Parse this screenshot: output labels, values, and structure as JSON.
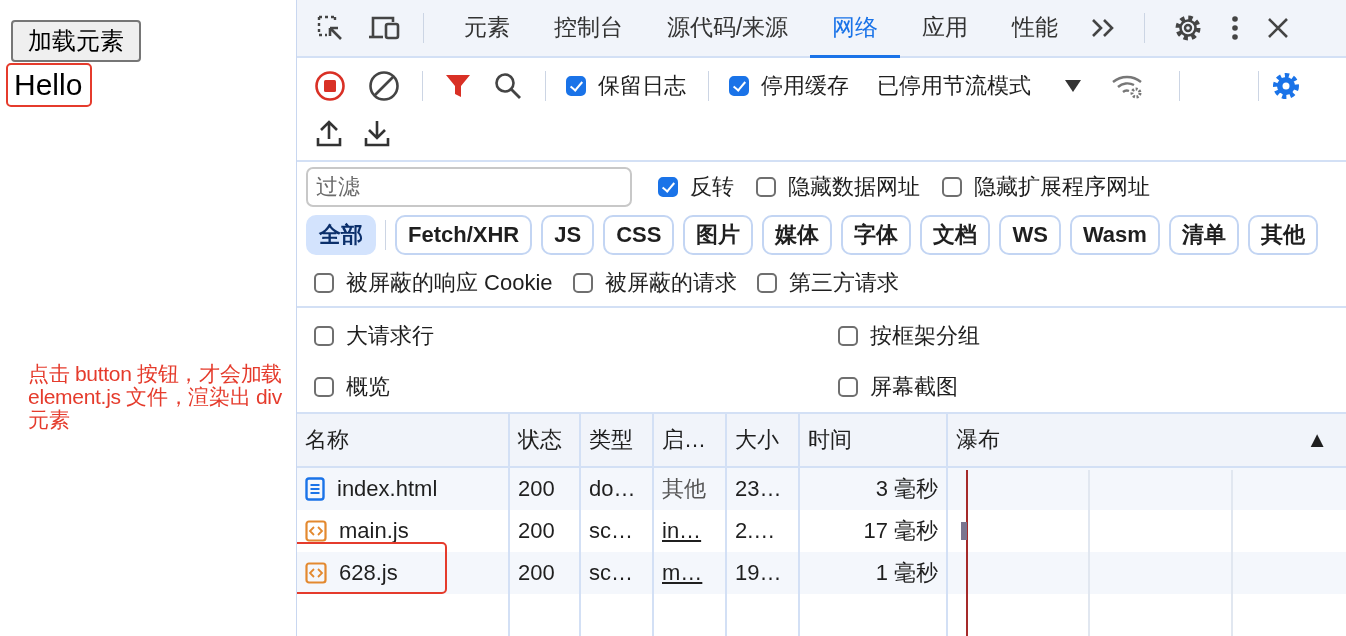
{
  "page": {
    "button": "加载元素",
    "hello": "Hello",
    "note": "点击 button 按钮，才会加载 element.js 文件，渲染出 div 元素"
  },
  "devtools": {
    "tabs": [
      {
        "label": "元素",
        "selected": false
      },
      {
        "label": "控制台",
        "selected": false
      },
      {
        "label": "源代码/来源",
        "selected": false
      },
      {
        "label": "网络",
        "selected": true
      },
      {
        "label": "应用",
        "selected": false
      },
      {
        "label": "性能",
        "selected": false
      }
    ],
    "toolbar": {
      "options": [
        {
          "label": "保留日志",
          "checked": true
        },
        {
          "label": "停用缓存",
          "checked": true
        }
      ],
      "throttling": "已停用节流模式"
    },
    "filter": {
      "placeholder": "过滤",
      "options": [
        {
          "label": "反转",
          "checked": true
        },
        {
          "label": "隐藏数据网址",
          "checked": false
        },
        {
          "label": "隐藏扩展程序网址",
          "checked": false
        }
      ]
    },
    "types": [
      {
        "label": "全部",
        "selected": true
      },
      {
        "label": "Fetch/XHR",
        "selected": false
      },
      {
        "label": "JS",
        "selected": false
      },
      {
        "label": "CSS",
        "selected": false
      },
      {
        "label": "图片",
        "selected": false
      },
      {
        "label": "媒体",
        "selected": false
      },
      {
        "label": "字体",
        "selected": false
      },
      {
        "label": "文档",
        "selected": false
      },
      {
        "label": "WS",
        "selected": false
      },
      {
        "label": "Wasm",
        "selected": false
      },
      {
        "label": "清单",
        "selected": false
      },
      {
        "label": "其他",
        "selected": false
      }
    ],
    "more_filters": [
      {
        "label": "被屏蔽的响应 Cookie",
        "checked": false
      },
      {
        "label": "被屏蔽的请求",
        "checked": false
      },
      {
        "label": "第三方请求",
        "checked": false
      }
    ],
    "settings": [
      {
        "label": "大请求行",
        "checked": false
      },
      {
        "label": "按框架分组",
        "checked": false
      },
      {
        "label": "概览",
        "checked": false
      },
      {
        "label": "屏幕截图",
        "checked": false
      }
    ],
    "table": {
      "columns": [
        "名称",
        "状态",
        "类型",
        "启…",
        "大小",
        "时间",
        "瀑布"
      ],
      "sort_indicator": "▲",
      "rows": [
        {
          "kind": "document",
          "name": "index.html",
          "status": "200",
          "type": "do…",
          "initiator": "其他",
          "initiator_link": false,
          "size": "23…",
          "time": "3 毫秒",
          "waterfall_bar": false
        },
        {
          "kind": "script",
          "name": "main.js",
          "status": "200",
          "type": "sc…",
          "initiator": "in…",
          "initiator_link": true,
          "size": "2.…",
          "time": "17 毫秒",
          "waterfall_bar": true
        },
        {
          "kind": "script",
          "name": "628.js",
          "status": "200",
          "type": "sc…",
          "initiator": "m…",
          "initiator_link": true,
          "size": "19…",
          "time": "1 毫秒",
          "waterfall_bar": false
        }
      ]
    }
  }
}
